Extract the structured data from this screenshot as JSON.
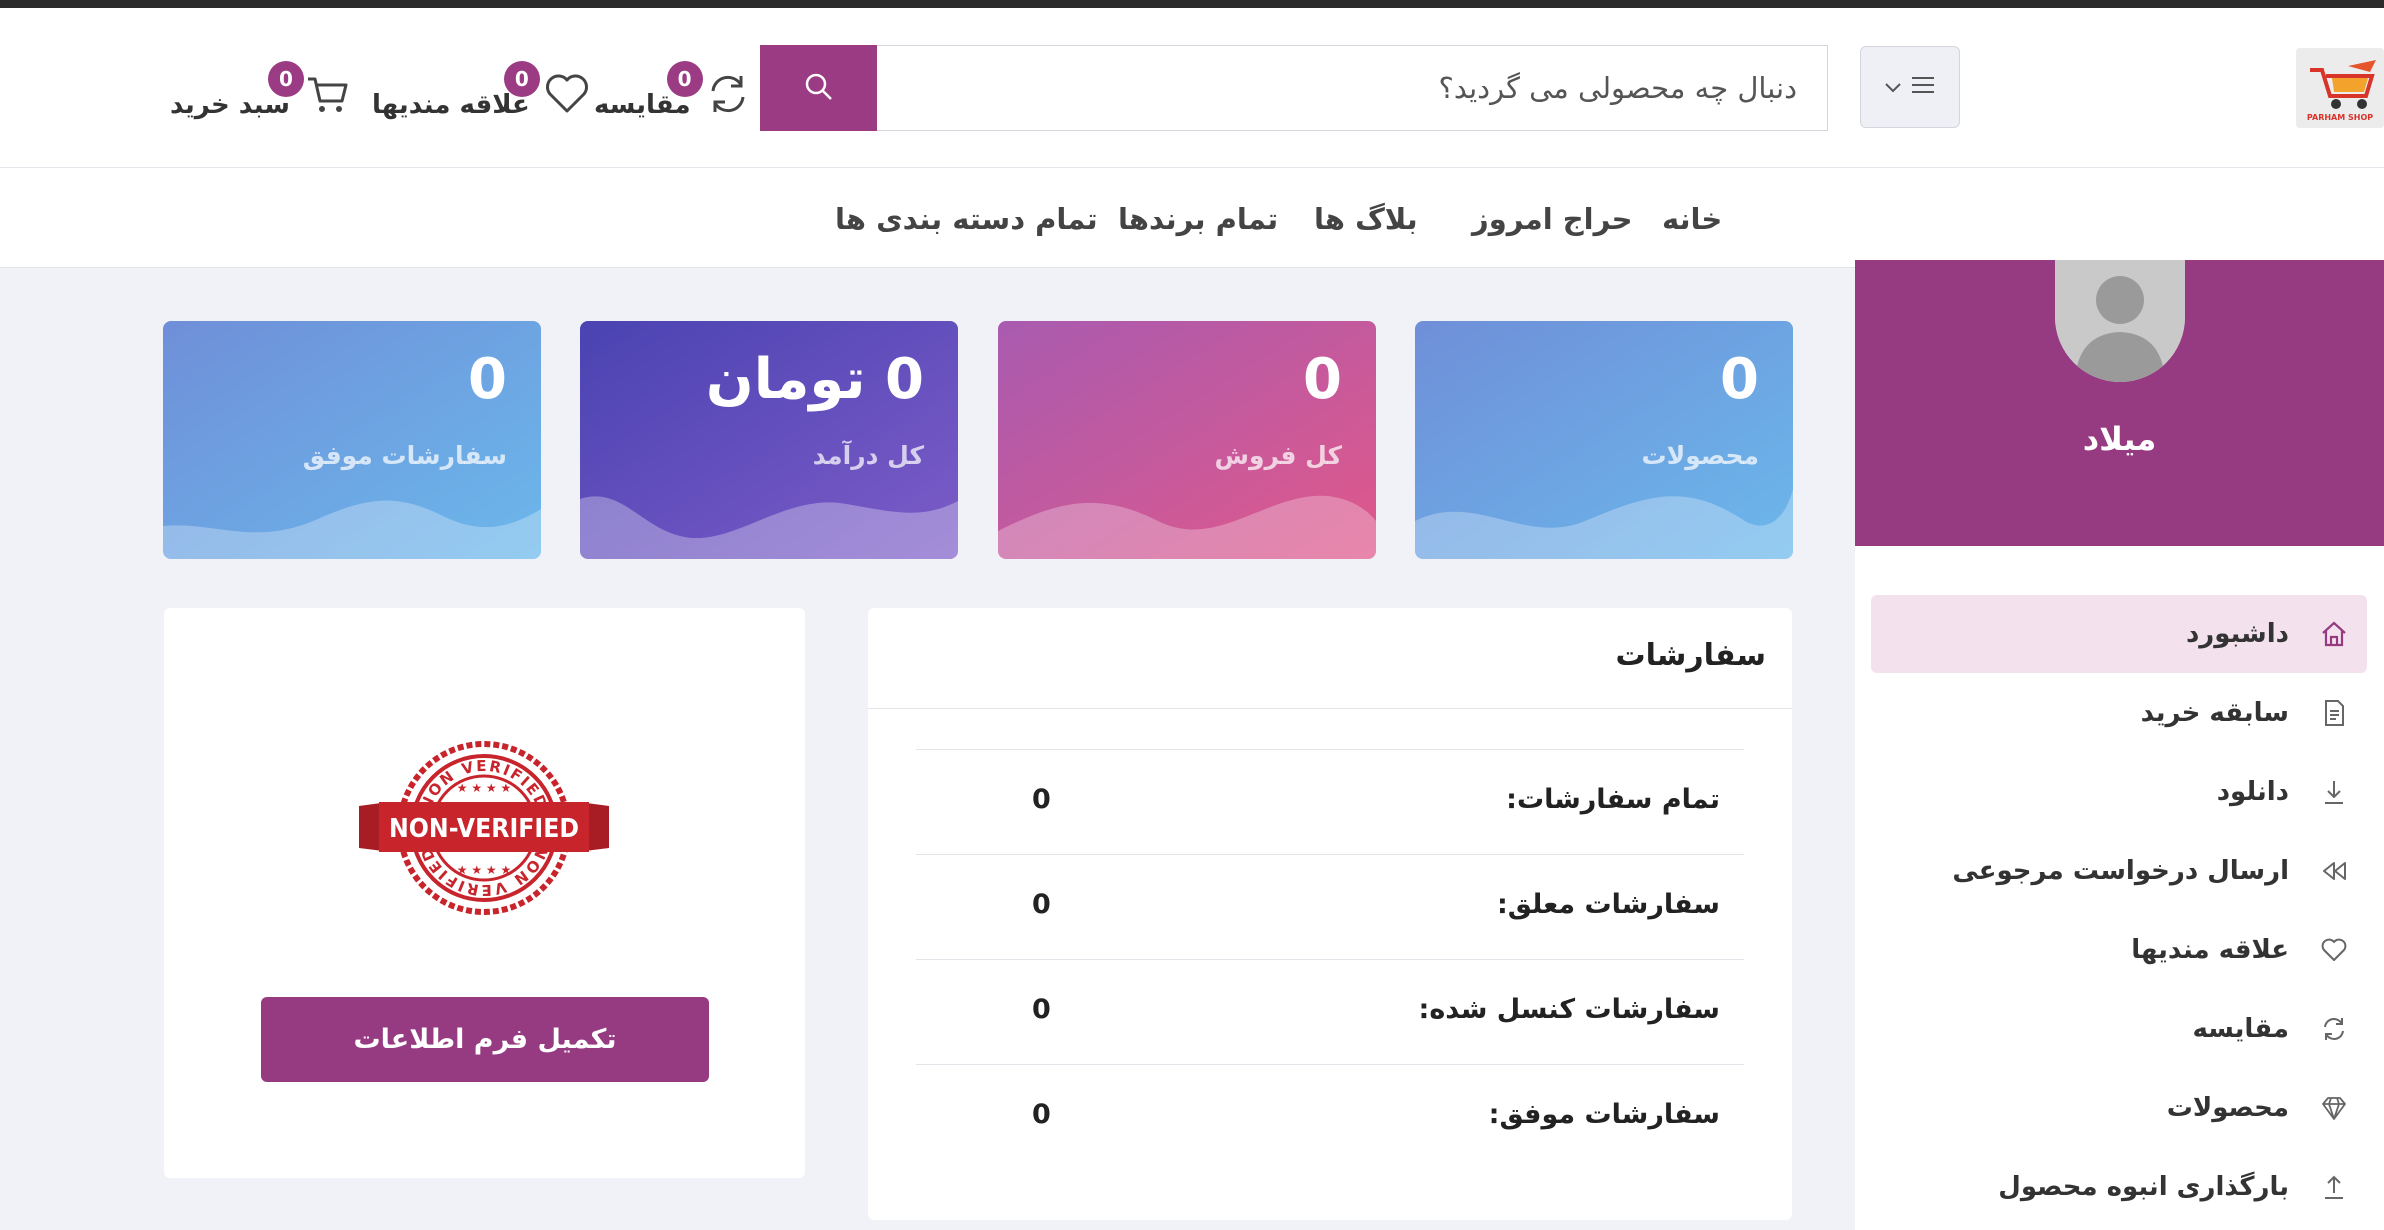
{
  "header": {
    "logo_text": "PARHAM SHOP",
    "search_placeholder": "دنبال چه محصولی می گردید؟",
    "compare": {
      "label": "مقایسه",
      "count": "0"
    },
    "wishlist": {
      "label": "علاقه مندیها",
      "count": "0"
    },
    "cart": {
      "label": "سبد خرید",
      "count": "0"
    }
  },
  "nav": {
    "items": [
      "خانه",
      "حراج امروز",
      "بلاگ ها",
      "تمام برندها",
      "تمام دسته بندی ها"
    ]
  },
  "profile": {
    "name": "میلاد"
  },
  "sidebar": {
    "items": [
      {
        "label": "داشبورد",
        "icon": "home-icon",
        "active": true
      },
      {
        "label": "سابقه خرید",
        "icon": "document-icon"
      },
      {
        "label": "دانلود",
        "icon": "download-icon"
      },
      {
        "label": "ارسال درخواست مرجوعی",
        "icon": "rewind-icon"
      },
      {
        "label": "علاقه مندیها",
        "icon": "heart-icon"
      },
      {
        "label": "مقایسه",
        "icon": "refresh-icon"
      },
      {
        "label": "محصولات",
        "icon": "diamond-icon"
      },
      {
        "label": "بارگذاری انبوه محصول",
        "icon": "upload-icon"
      }
    ]
  },
  "stats": [
    {
      "value": "0",
      "label": "محصولات",
      "colors": [
        "#6f8fd8",
        "#6bb8ec"
      ]
    },
    {
      "value": "0",
      "label": "کل فروش",
      "colors": [
        "#a95bb0",
        "#e0588a"
      ]
    },
    {
      "value": "0 تومان",
      "label": "کل درآمد",
      "colors": [
        "#4a43b2",
        "#7d5cc8"
      ]
    },
    {
      "value": "0",
      "label": "سفارشات موفق",
      "colors": [
        "#6f8fd8",
        "#6bb8ec"
      ]
    }
  ],
  "orders": {
    "title": "سفارشات",
    "rows": [
      {
        "label": "تمام سفارشات:",
        "value": "0"
      },
      {
        "label": "سفارشات معلق:",
        "value": "0"
      },
      {
        "label": "سفارشات کنسل شده:",
        "value": "0"
      },
      {
        "label": "سفارشات موفق:",
        "value": "0"
      }
    ]
  },
  "verify": {
    "stamp_text": "NON-VERIFIED",
    "stamp_ring_text": "NON VERIFIED",
    "button_label": "تکمیل فرم اطلاعات"
  },
  "colors": {
    "accent": "#963a82",
    "active_bg": "#f3e2ee",
    "page_bg": "#f1f2f7"
  }
}
